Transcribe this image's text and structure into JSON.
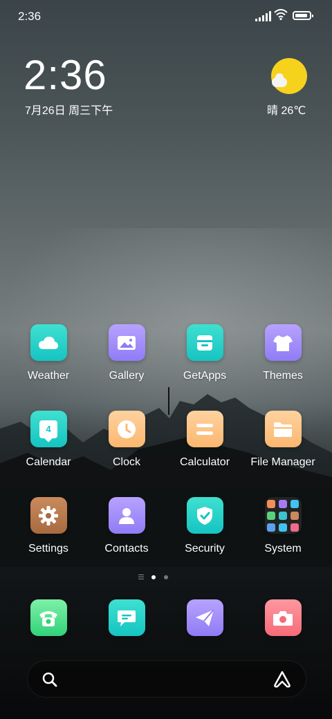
{
  "status_bar": {
    "time": "2:36",
    "battery_level": 0.9
  },
  "clock_widget": {
    "time": "2:36",
    "date": "7月26日 周三下午"
  },
  "weather_widget": {
    "condition_temp": "晴 26℃",
    "icon": "sunny-partly-cloudy-icon"
  },
  "apps": [
    {
      "label": "Weather",
      "icon": "cloud-icon",
      "colors": [
        "#3fe0d0",
        "#16c4c2"
      ]
    },
    {
      "label": "Gallery",
      "icon": "image-icon",
      "colors": [
        "#b8a2ff",
        "#8f7cf5"
      ]
    },
    {
      "label": "GetApps",
      "icon": "store-icon",
      "colors": [
        "#3fe0d0",
        "#16c4c2"
      ]
    },
    {
      "label": "Themes",
      "icon": "tshirt-icon",
      "colors": [
        "#b8a2ff",
        "#8f7cf5"
      ]
    },
    {
      "label": "Calendar",
      "icon": "calendar-icon",
      "calendar_day": "4",
      "colors": [
        "#3fe0d0",
        "#16c4c2"
      ]
    },
    {
      "label": "Clock",
      "icon": "clock-icon",
      "colors": [
        "#ffd2a0",
        "#fbb76f"
      ]
    },
    {
      "label": "Calculator",
      "icon": "equals-icon",
      "colors": [
        "#ffd2a0",
        "#fbb76f"
      ]
    },
    {
      "label": "File Manager",
      "icon": "folder-icon",
      "colors": [
        "#ffd2a0",
        "#fbb76f"
      ]
    },
    {
      "label": "Settings",
      "icon": "gear-icon",
      "colors": [
        "#c98a5c",
        "#a86a3f"
      ]
    },
    {
      "label": "Contacts",
      "icon": "person-icon",
      "colors": [
        "#b8a2ff",
        "#8f7cf5"
      ]
    },
    {
      "label": "Security",
      "icon": "shield-check-icon",
      "colors": [
        "#3fe0d0",
        "#16c4c2"
      ]
    },
    {
      "label": "System",
      "icon": "folder-grid-icon",
      "colors": [
        "#2a2a2a",
        "#2a2a2a"
      ]
    }
  ],
  "folder_mini_icon_colors": [
    "#f08f5b",
    "#a57bf5",
    "#3ec4f0",
    "#57d27a",
    "#3ec4d0",
    "#c98a5c",
    "#5aa2f0",
    "#3ec4f0",
    "#f06b8a"
  ],
  "page_indicator": {
    "pages": 2,
    "current": 1
  },
  "dock": [
    {
      "icon": "phone-icon",
      "colors": [
        "#7ef0a8",
        "#32d27a"
      ]
    },
    {
      "icon": "message-icon",
      "colors": [
        "#3fe0d0",
        "#16c4c2"
      ]
    },
    {
      "icon": "send-icon",
      "colors": [
        "#b8a2ff",
        "#8f7cf5"
      ]
    },
    {
      "icon": "camera-icon",
      "colors": [
        "#ff97a0",
        "#f56b78"
      ]
    }
  ],
  "search_bar": {
    "icons": [
      "search-icon",
      "assistant-icon"
    ]
  }
}
